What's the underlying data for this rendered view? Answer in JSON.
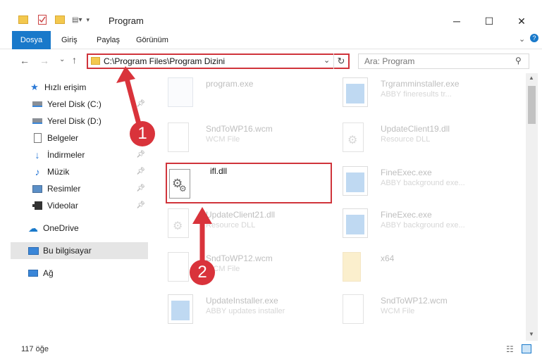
{
  "window": {
    "title": "Program",
    "minimize": "─",
    "maximize": "☐",
    "close": "✕"
  },
  "ribbon": {
    "tabs": [
      "Dosya",
      "Giriş",
      "Paylaş",
      "Görünüm"
    ]
  },
  "address": {
    "path": "C:\\Program Files\\Program Dizini"
  },
  "search": {
    "placeholder": "Ara: Program"
  },
  "sidebar": {
    "items": [
      {
        "label": "Hızlı erişim",
        "icon": "star-icon"
      },
      {
        "label": "Yerel Disk (C:)",
        "icon": "drive-icon"
      },
      {
        "label": "Yerel Disk (D:)",
        "icon": "drive-icon"
      },
      {
        "label": "Belgeler",
        "icon": "documents-icon"
      },
      {
        "label": "İndirmeler",
        "icon": "download-icon"
      },
      {
        "label": "Müzik",
        "icon": "music-icon"
      },
      {
        "label": "Resimler",
        "icon": "pictures-icon"
      },
      {
        "label": "Videolar",
        "icon": "video-icon"
      },
      {
        "label": "OneDrive",
        "icon": "cloud-icon"
      },
      {
        "label": "Bu bilgisayar",
        "icon": "computer-icon"
      },
      {
        "label": "Ağ",
        "icon": "network-icon"
      }
    ]
  },
  "files": [
    {
      "name": "program.exe",
      "sub": "",
      "kind": "exe"
    },
    {
      "name": "Trgramminstaller.exe",
      "sub": "ABBY fineresults tr...",
      "kind": "blue"
    },
    {
      "name": "SndToWP16.wcm",
      "sub": "WCM File",
      "kind": "doc"
    },
    {
      "name": "UpdateClient19.dll",
      "sub": "Resource DLL",
      "kind": "dll"
    },
    {
      "name": "ifl.dll",
      "sub": "",
      "kind": "dll"
    },
    {
      "name": "FineExec.exe",
      "sub": "ABBY background exe...",
      "kind": "blue"
    },
    {
      "name": "UpdateClient21.dll",
      "sub": "Resource DLL",
      "kind": "dll"
    },
    {
      "name": "FineExec.exe",
      "sub": "ABBY background exe...",
      "kind": "blue"
    },
    {
      "name": "SndToWP12.wcm",
      "sub": "WCM File",
      "kind": "doc"
    },
    {
      "name": "x64",
      "sub": "",
      "kind": "folder"
    },
    {
      "name": "UpdateInstaller.exe",
      "sub": "ABBY updates installer",
      "kind": "blue"
    },
    {
      "name": "SndToWP12.wcm",
      "sub": "WCM File",
      "kind": "doc"
    }
  ],
  "status": {
    "count": "117 öğe"
  },
  "annotations": {
    "step1": "1",
    "step2": "2",
    "color": "#d9333b"
  }
}
